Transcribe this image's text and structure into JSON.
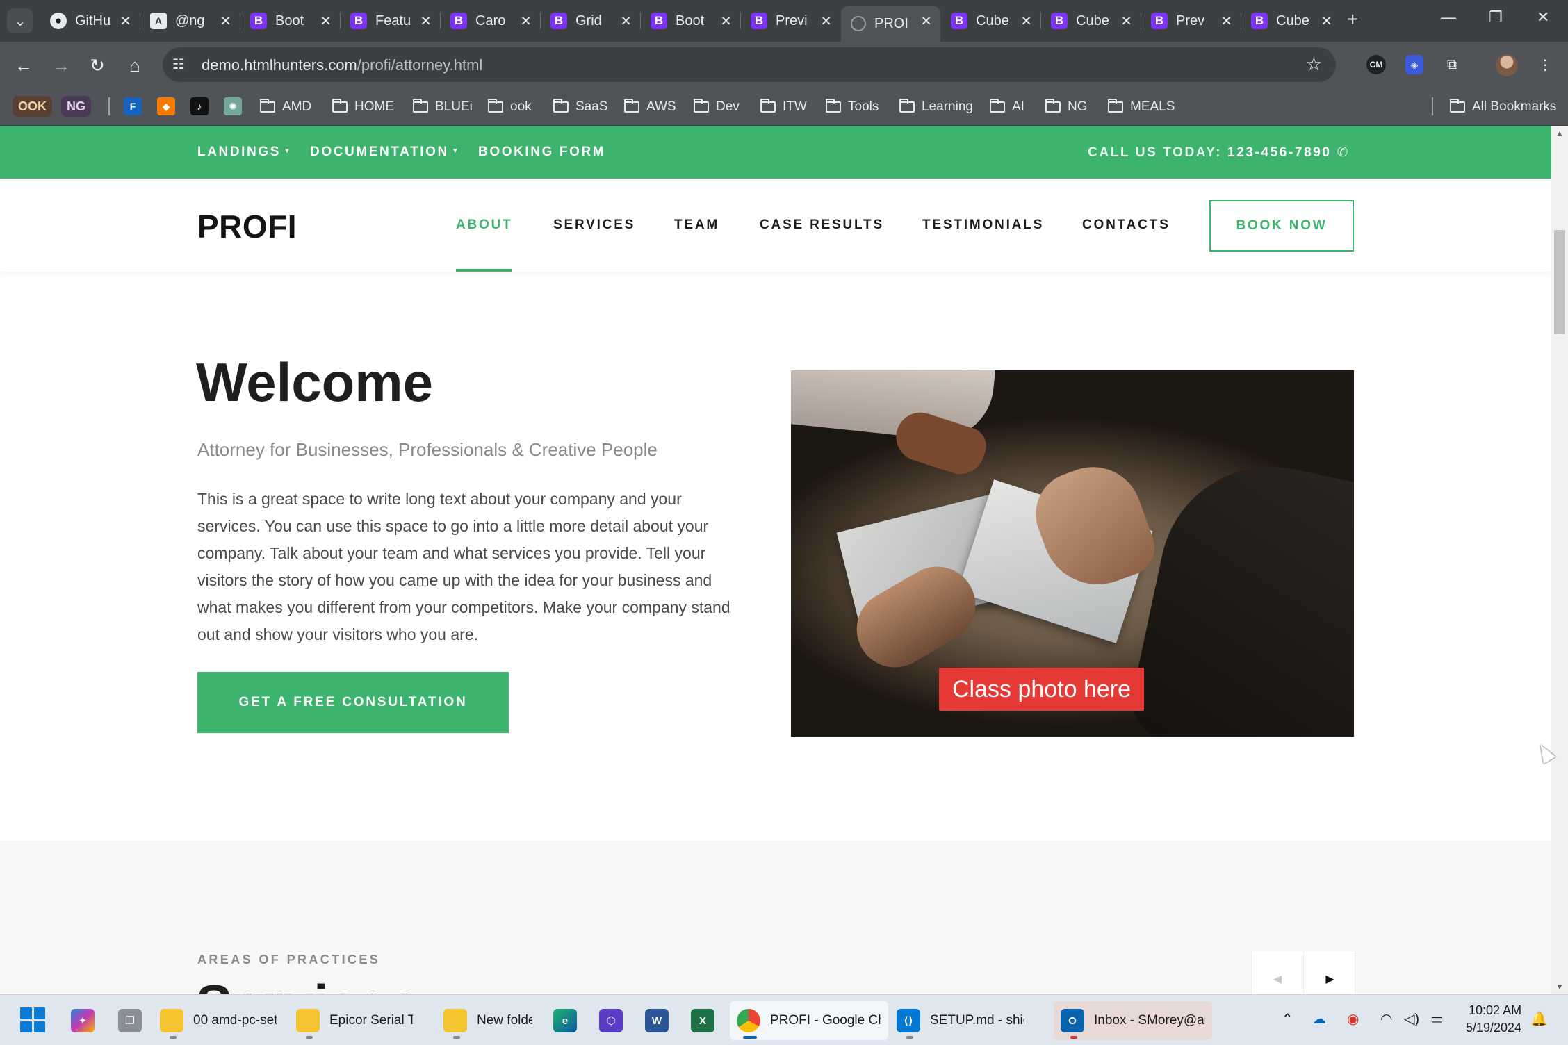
{
  "browser": {
    "tabs": [
      {
        "icon": "github-icon",
        "label": "GitHub"
      },
      {
        "icon": "angular-icon",
        "label": "@ng"
      },
      {
        "icon": "bootstrap-icon",
        "label": "Boot"
      },
      {
        "icon": "bootstrap-icon",
        "label": "Featu"
      },
      {
        "icon": "bootstrap-icon",
        "label": "Caro"
      },
      {
        "icon": "bootstrap-icon",
        "label": "Grid"
      },
      {
        "icon": "bootstrap-icon",
        "label": "Boot"
      },
      {
        "icon": "bootstrap-icon",
        "label": "Previ"
      },
      {
        "icon": "globe-icon",
        "label": "PROI",
        "active": true
      },
      {
        "icon": "bootstrap-icon",
        "label": "Cube"
      },
      {
        "icon": "bootstrap-icon",
        "label": "Cube"
      },
      {
        "icon": "bootstrap-icon",
        "label": "Prev"
      },
      {
        "icon": "bootstrap-icon",
        "label": "Cube"
      }
    ],
    "url_host": "demo.htmlhunters.com",
    "url_path": "/profi/attorney.html",
    "bookmarks": {
      "pills": [
        "OOK",
        "NG"
      ],
      "folders": [
        "AMD",
        "HOME",
        "BLUEi",
        "ook",
        "SaaS",
        "AWS",
        "Dev",
        "ITW",
        "Tools",
        "Learning",
        "AI",
        "NG",
        "MEALS"
      ],
      "all_bookmarks": "All Bookmarks"
    }
  },
  "site": {
    "topbar": {
      "links": [
        "LANDINGS",
        "DOCUMENTATION",
        "BOOKING FORM"
      ],
      "call_label": "CALL US TODAY:",
      "phone": "123-456-7890"
    },
    "logo": "PROFI",
    "nav": [
      "ABOUT",
      "SERVICES",
      "TEAM",
      "CASE RESULTS",
      "TESTIMONIALS",
      "CONTACTS"
    ],
    "nav_active": "ABOUT",
    "book_now": "BOOK NOW",
    "welcome": {
      "title": "Welcome",
      "subtitle": "Attorney for Businesses, Professionals & Creative People",
      "body": "This is a great space to write long text about your company and your services. You can use this space to go into a little more detail about your company. Talk about your team and what services you provide. Tell your visitors the story of how you came up with the idea for your business and what makes you different from your competitors. Make your company stand out and show your visitors who you are.",
      "cta": "GET A FREE CONSULTATION",
      "photo_caption": "Class photo here"
    },
    "practices": {
      "kicker": "AREAS OF PRACTICES",
      "title": "Services"
    }
  },
  "taskbar": {
    "apps": [
      {
        "label": "00 amd-pc-set"
      },
      {
        "label": "Epicor Serial Tracl"
      },
      {
        "label": "New folde"
      },
      {
        "label": "PROFI - Google Chr",
        "active": true
      },
      {
        "label": "SETUP.md - shidok"
      },
      {
        "label": "Inbox - SMorey@au"
      }
    ],
    "time": "10:02 AM",
    "date": "5/19/2024"
  },
  "colors": {
    "accent": "#3cb46e",
    "caption_bg": "#e53935",
    "chrome_dark": "#3c4043"
  }
}
